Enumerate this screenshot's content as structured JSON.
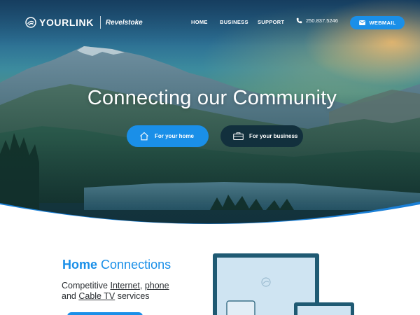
{
  "nav": {
    "brand": "YOURLINK",
    "city": "Revelstoke",
    "links": [
      "HOME",
      "BUSINESS",
      "SUPPORT"
    ],
    "phone": "250.837.5246",
    "webmail": "WEBMAIL"
  },
  "hero": {
    "title": "Connecting our Community",
    "cta_home": "For your home",
    "cta_business": "For your business"
  },
  "connections": {
    "title_strong": "Home",
    "title_rest": "Connections",
    "line1_prefix": "Competitive ",
    "link_internet": "Internet",
    "comma": ", ",
    "link_phone": "phone",
    "line2_prefix": "and ",
    "link_cable": "Cable TV",
    "line2_suffix": " services"
  },
  "colors": {
    "accent": "#1a8fe8",
    "dark_button": "#12303d",
    "device_frame": "#1f5a73",
    "device_screen": "#cfe4f2",
    "text": "#2b2f33"
  },
  "icons": [
    "wifi-logo-icon",
    "phone-icon",
    "mail-icon",
    "house-icon",
    "briefcase-icon"
  ]
}
